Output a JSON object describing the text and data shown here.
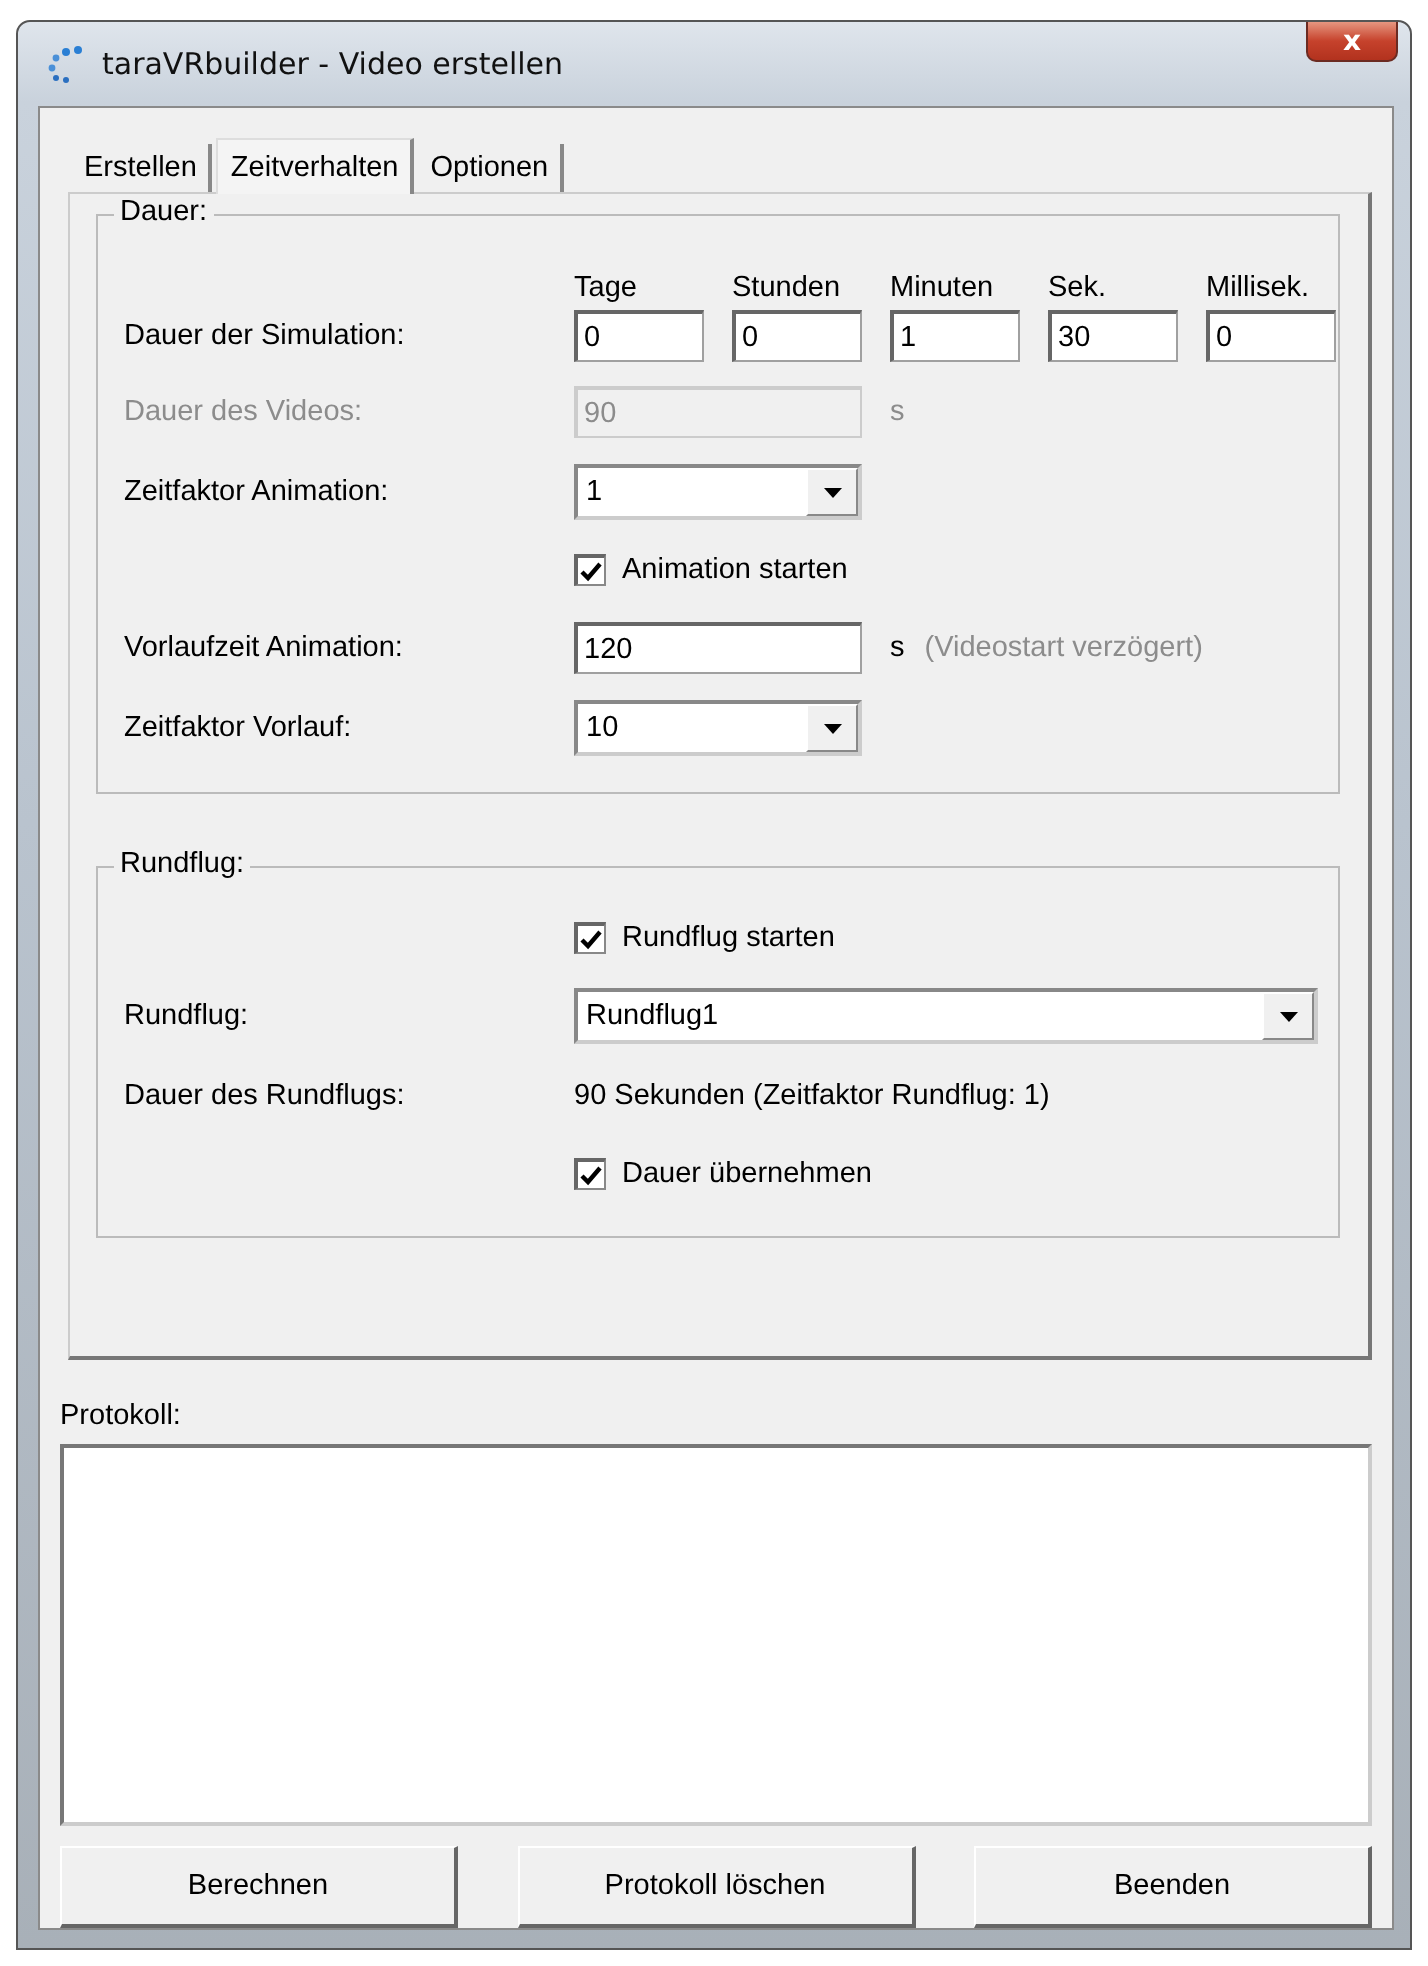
{
  "window": {
    "title": "taraVRbuilder - Video erstellen",
    "close": "x"
  },
  "tabs": [
    {
      "label": "Erstellen",
      "selected": false
    },
    {
      "label": "Zeitverhalten",
      "selected": true
    },
    {
      "label": "Optionen",
      "selected": false
    }
  ],
  "groups": [
    {
      "legend": "Dauer:",
      "rows": [
        {
          "kind": "timefields",
          "label": "Dauer der Simulation:",
          "headers": [
            "Tage",
            "Stunden",
            "Minuten",
            "Sek.",
            "Millisek."
          ],
          "values": [
            "0",
            "0",
            "1",
            "30",
            "0"
          ]
        },
        {
          "kind": "field",
          "label": "Dauer des Videos:",
          "value": "90",
          "unit": "s",
          "disabled": true
        },
        {
          "kind": "combo",
          "label": "Zeitfaktor Animation:",
          "value": "1",
          "wide": false
        },
        {
          "kind": "checkbox",
          "label": "Animation starten",
          "checked": true
        },
        {
          "kind": "field",
          "label": "Vorlaufzeit Animation:",
          "value": "120",
          "unit": "s",
          "note": "(Videostart verzögert)",
          "disabled": false
        },
        {
          "kind": "combo",
          "label": "Zeitfaktor Vorlauf:",
          "value": "10",
          "wide": false
        }
      ]
    },
    {
      "legend": "Rundflug:",
      "rows": [
        {
          "kind": "checkbox",
          "label": "Rundflug starten",
          "checked": true
        },
        {
          "kind": "combo",
          "label": "Rundflug:",
          "value": "Rundflug1",
          "wide": true
        },
        {
          "kind": "text",
          "label": "Dauer des Rundflugs:",
          "value": "90 Sekunden (Zeitfaktor Rundflug: 1)"
        },
        {
          "kind": "checkbox",
          "label": "Dauer übernehmen",
          "checked": true
        }
      ]
    }
  ],
  "protokoll": {
    "label": "Protokoll:"
  },
  "buttons": [
    "Berechnen",
    "Protokoll löschen",
    "Beenden"
  ]
}
